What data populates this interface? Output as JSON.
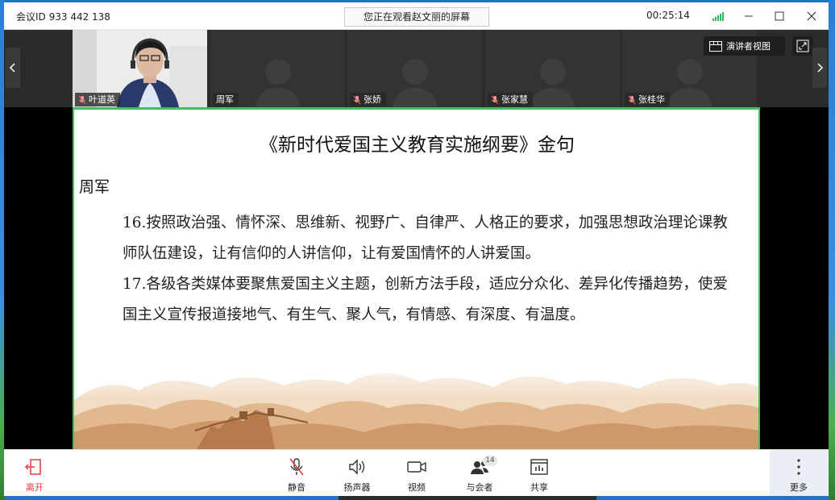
{
  "window": {
    "meeting_id": "会议ID 933 442 138",
    "sharing_banner": "您正在观看赵文丽的屏幕",
    "elapsed_time": "00:25:14"
  },
  "participants": [
    {
      "name": "叶道英",
      "muted": true,
      "video_on": true
    },
    {
      "name": "周军",
      "muted": false,
      "video_on": false
    },
    {
      "name": "张娇",
      "muted": true,
      "video_on": false
    },
    {
      "name": "张家慧",
      "muted": true,
      "video_on": false
    },
    {
      "name": "张桂华",
      "muted": true,
      "video_on": false
    }
  ],
  "view_controls": {
    "speaker_view_label": "演讲者视图"
  },
  "slide": {
    "title": "《新时代爱国主义教育实施纲要》金句",
    "author": "周军",
    "paragraphs": [
      "16.按照政治强、情怀深、思维新、视野广、自律严、人格正的要求，加强思想政治理论课教师队伍建设，让有信仰的人讲信仰，让有爱国情怀的人讲爱国。",
      "17.各级各类媒体要聚焦爱国主义主题，创新方法手段，适应分众化、差异化传播趋势，使爱国主义宣传报道接地气、有生气、聚人气，有情感、有深度、有温度。"
    ]
  },
  "toolbar": {
    "leave": "离开",
    "mute": "静音",
    "speaker": "扬声器",
    "video": "视频",
    "participants": "与会者",
    "participants_count": "14",
    "share": "共享",
    "more": "更多"
  },
  "colors": {
    "accent_green": "#3fbf5f",
    "leave_red": "#e23b3b",
    "signal_green": "#3bb55a"
  }
}
